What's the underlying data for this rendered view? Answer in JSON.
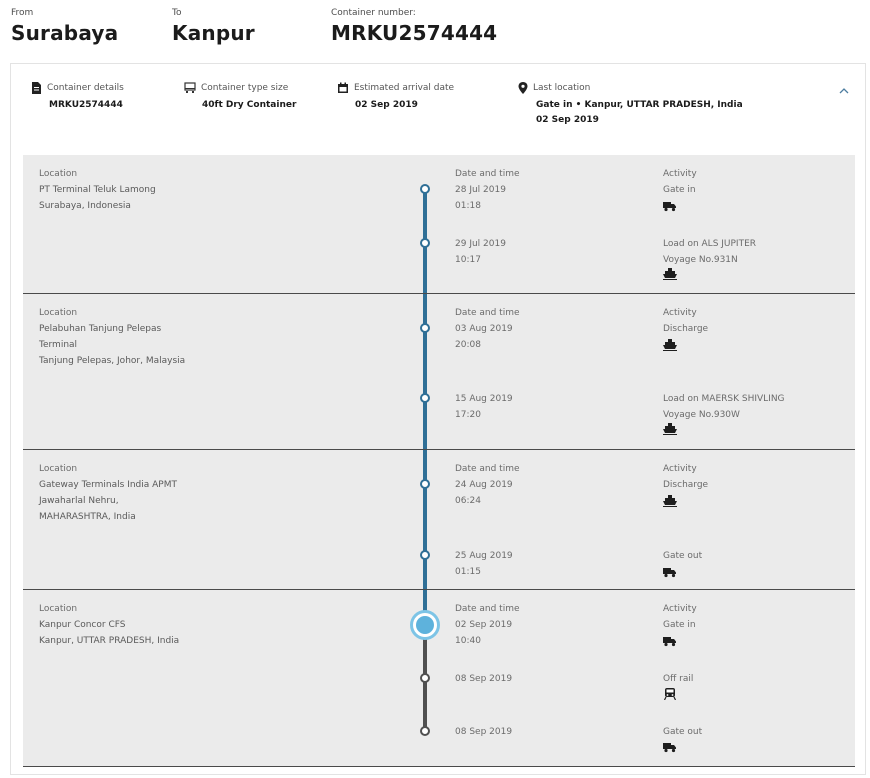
{
  "header": {
    "from_label": "From",
    "from_value": "Surabaya",
    "to_label": "To",
    "to_value": "Kanpur",
    "container_label": "Container number:",
    "container_value": "MRKU2574444"
  },
  "summary": {
    "details_label": "Container details",
    "details_value": "MRKU2574444",
    "type_label": "Container type size",
    "type_value": "40ft Dry Container",
    "eta_label": "Estimated arrival date",
    "eta_value": "02 Sep 2019",
    "last_label": "Last location",
    "last_value": "Gate in • Kanpur, UTTAR PRADESH, India",
    "last_date": "02 Sep 2019"
  },
  "column_labels": {
    "location": "Location",
    "datetime": "Date and time",
    "activity": "Activity"
  },
  "locations": [
    {
      "lines": [
        "PT Terminal Teluk Lamong",
        "Surabaya, Indonesia"
      ],
      "events": [
        {
          "date": "28 Jul 2019",
          "time": "01:18",
          "activity": "Gate in",
          "voyage": "",
          "icon": "truck-icon"
        },
        {
          "date": "29 Jul 2019",
          "time": "10:17",
          "activity": "Load on ALS JUPITER",
          "voyage": "Voyage No.931N",
          "icon": "ship-icon"
        }
      ]
    },
    {
      "lines": [
        "Pelabuhan Tanjung Pelepas",
        "Terminal",
        "Tanjung Pelepas, Johor, Malaysia"
      ],
      "events": [
        {
          "date": "03 Aug 2019",
          "time": "20:08",
          "activity": "Discharge",
          "voyage": "",
          "icon": "ship-icon"
        },
        {
          "date": "15 Aug 2019",
          "time": "17:20",
          "activity": "Load on MAERSK SHIVLING",
          "voyage": "Voyage No.930W",
          "icon": "ship-icon"
        }
      ]
    },
    {
      "lines": [
        "Gateway Terminals India APMT",
        "Jawaharlal Nehru,",
        "MAHARASHTRA, India"
      ],
      "events": [
        {
          "date": "24 Aug 2019",
          "time": "06:24",
          "activity": "Discharge",
          "voyage": "",
          "icon": "ship-icon"
        },
        {
          "date": "25 Aug 2019",
          "time": "01:15",
          "activity": "Gate out",
          "voyage": "",
          "icon": "truck-icon"
        }
      ]
    },
    {
      "lines": [
        "Kanpur Concor CFS",
        "Kanpur, UTTAR PRADESH, India"
      ],
      "events": [
        {
          "date": "02 Sep 2019",
          "time": "10:40",
          "activity": "Gate in",
          "voyage": "",
          "icon": "truck-icon"
        },
        {
          "date": "08 Sep 2019",
          "time": "",
          "activity": "Off rail",
          "voyage": "",
          "icon": "train-icon"
        },
        {
          "date": "08 Sep 2019",
          "time": "",
          "activity": "Gate out",
          "voyage": "",
          "icon": "truck-icon"
        }
      ]
    }
  ],
  "colors": {
    "completed_line": "#2f6f96",
    "future_line": "#4f4f4f",
    "current_marker": "#5eb2dc"
  }
}
